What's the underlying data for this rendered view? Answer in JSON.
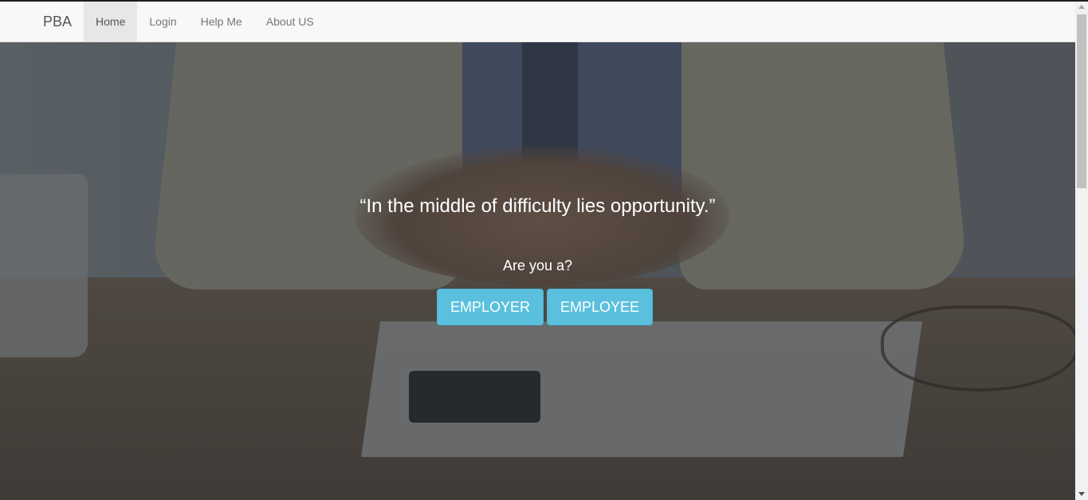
{
  "navbar": {
    "brand": "PBA",
    "items": [
      {
        "label": "Home",
        "active": true
      },
      {
        "label": "Login",
        "active": false
      },
      {
        "label": "Help Me",
        "active": false
      },
      {
        "label": "About US",
        "active": false
      }
    ]
  },
  "hero": {
    "quote": "“In the middle of difficulty lies opportunity.”",
    "question": "Are you a?",
    "buttons": {
      "employer": "EMPLOYER",
      "employee": "EMPLOYEE"
    }
  },
  "colors": {
    "button_accent": "#5bc0de",
    "navbar_bg": "#f8f8f8",
    "active_nav_bg": "#e7e7e7"
  }
}
